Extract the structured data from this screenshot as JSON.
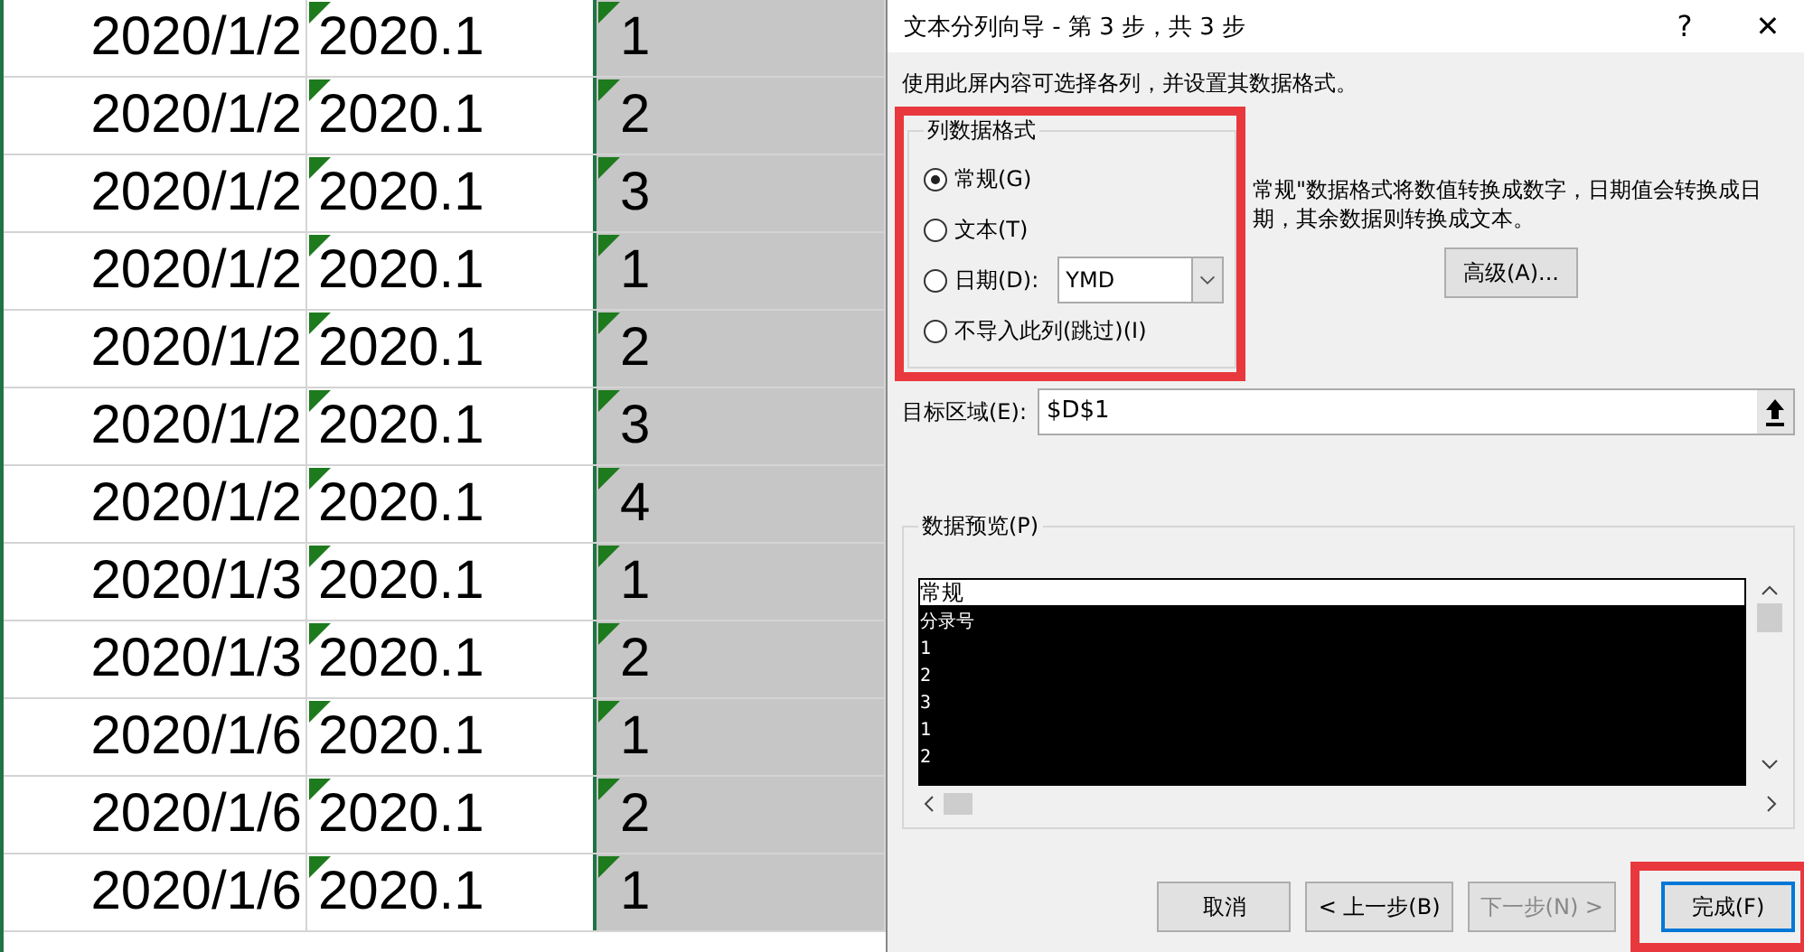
{
  "sheet": {
    "rows": [
      {
        "date": "2020/1/2",
        "period": "2020.1",
        "entry": "1"
      },
      {
        "date": "2020/1/2",
        "period": "2020.1",
        "entry": "2"
      },
      {
        "date": "2020/1/2",
        "period": "2020.1",
        "entry": "3"
      },
      {
        "date": "2020/1/2",
        "period": "2020.1",
        "entry": "1"
      },
      {
        "date": "2020/1/2",
        "period": "2020.1",
        "entry": "2"
      },
      {
        "date": "2020/1/2",
        "period": "2020.1",
        "entry": "3"
      },
      {
        "date": "2020/1/2",
        "period": "2020.1",
        "entry": "4"
      },
      {
        "date": "2020/1/3",
        "period": "2020.1",
        "entry": "1"
      },
      {
        "date": "2020/1/3",
        "period": "2020.1",
        "entry": "2"
      },
      {
        "date": "2020/1/6",
        "period": "2020.1",
        "entry": "1"
      },
      {
        "date": "2020/1/6",
        "period": "2020.1",
        "entry": "2"
      },
      {
        "date": "2020/1/6",
        "period": "2020.1",
        "entry": "1"
      }
    ]
  },
  "dialog": {
    "title": "文本分列向导 - 第 3 步，共 3 步",
    "help": "?",
    "close": "✕",
    "instruction": "使用此屏内容可选择各列，并设置其数据格式。",
    "format_group": {
      "title": "列数据格式",
      "options": [
        {
          "label": "常规(G)",
          "selected": true
        },
        {
          "label": "文本(T)",
          "selected": false
        },
        {
          "label": "日期(D):",
          "selected": false,
          "dropdown": "YMD"
        },
        {
          "label": "不导入此列(跳过)(I)",
          "selected": false
        }
      ]
    },
    "hint_lines": [
      "常规\"数据格式将数值转换成数字，日期值会转换成日",
      "期，其余数据则转换成文本。"
    ],
    "advanced_button": "高级(A)...",
    "destination": {
      "label": "目标区域(E):",
      "value": "$D$1"
    },
    "preview": {
      "title": "数据预览(P)",
      "header": "常规",
      "rows": [
        "分录号",
        "1",
        "2",
        "3",
        "1",
        "2"
      ]
    },
    "buttons": [
      {
        "label": "取消",
        "disabled": false,
        "default": false
      },
      {
        "label": "< 上一步(B)",
        "disabled": false,
        "default": false
      },
      {
        "label": "下一步(N) >",
        "disabled": true,
        "default": false
      },
      {
        "label": "完成(F)",
        "disabled": false,
        "default": true
      }
    ]
  }
}
